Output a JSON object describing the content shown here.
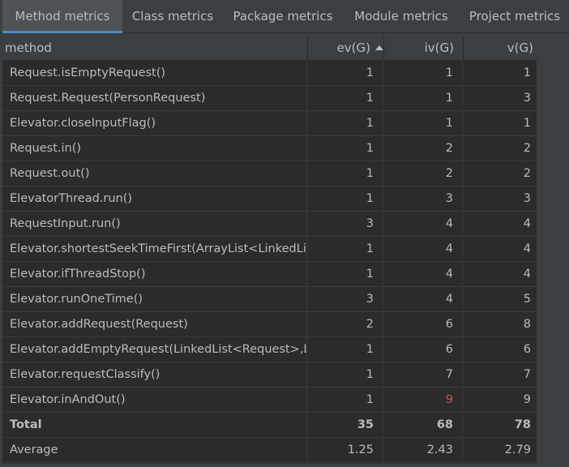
{
  "tabs": [
    {
      "label": "Method metrics",
      "active": true
    },
    {
      "label": "Class metrics",
      "active": false
    },
    {
      "label": "Package metrics",
      "active": false
    },
    {
      "label": "Module metrics",
      "active": false
    },
    {
      "label": "Project metrics",
      "active": false
    }
  ],
  "columns": [
    "method",
    "ev(G)",
    "iv(G)",
    "v(G)"
  ],
  "sort_indicator": "ascending",
  "rows": [
    {
      "method": "Request.isEmptyRequest()",
      "ev": "1",
      "iv": "1",
      "v": "1"
    },
    {
      "method": "Request.Request(PersonRequest)",
      "ev": "1",
      "iv": "1",
      "v": "3"
    },
    {
      "method": "Elevator.closeInputFlag()",
      "ev": "1",
      "iv": "1",
      "v": "1"
    },
    {
      "method": "Request.in()",
      "ev": "1",
      "iv": "2",
      "v": "2"
    },
    {
      "method": "Request.out()",
      "ev": "1",
      "iv": "2",
      "v": "2"
    },
    {
      "method": "ElevatorThread.run()",
      "ev": "1",
      "iv": "3",
      "v": "3"
    },
    {
      "method": "RequestInput.run()",
      "ev": "3",
      "iv": "4",
      "v": "4"
    },
    {
      "method": "Elevator.shortestSeekTimeFirst(ArrayList<LinkedLi",
      "ev": "1",
      "iv": "4",
      "v": "4"
    },
    {
      "method": "Elevator.ifThreadStop()",
      "ev": "1",
      "iv": "4",
      "v": "4"
    },
    {
      "method": "Elevator.runOneTime()",
      "ev": "3",
      "iv": "4",
      "v": "5"
    },
    {
      "method": "Elevator.addRequest(Request)",
      "ev": "2",
      "iv": "6",
      "v": "8"
    },
    {
      "method": "Elevator.addEmptyRequest(LinkedList<Request>,L",
      "ev": "1",
      "iv": "6",
      "v": "6"
    },
    {
      "method": "Elevator.requestClassify()",
      "ev": "1",
      "iv": "7",
      "v": "7"
    },
    {
      "method": "Elevator.inAndOut()",
      "ev": "1",
      "iv": "9",
      "v": "9",
      "iv_color": "#c75450"
    }
  ],
  "total": {
    "label": "Total",
    "ev": "35",
    "iv": "68",
    "v": "78"
  },
  "average": {
    "label": "Average",
    "ev": "1.25",
    "iv": "2.43",
    "v": "2.79"
  }
}
